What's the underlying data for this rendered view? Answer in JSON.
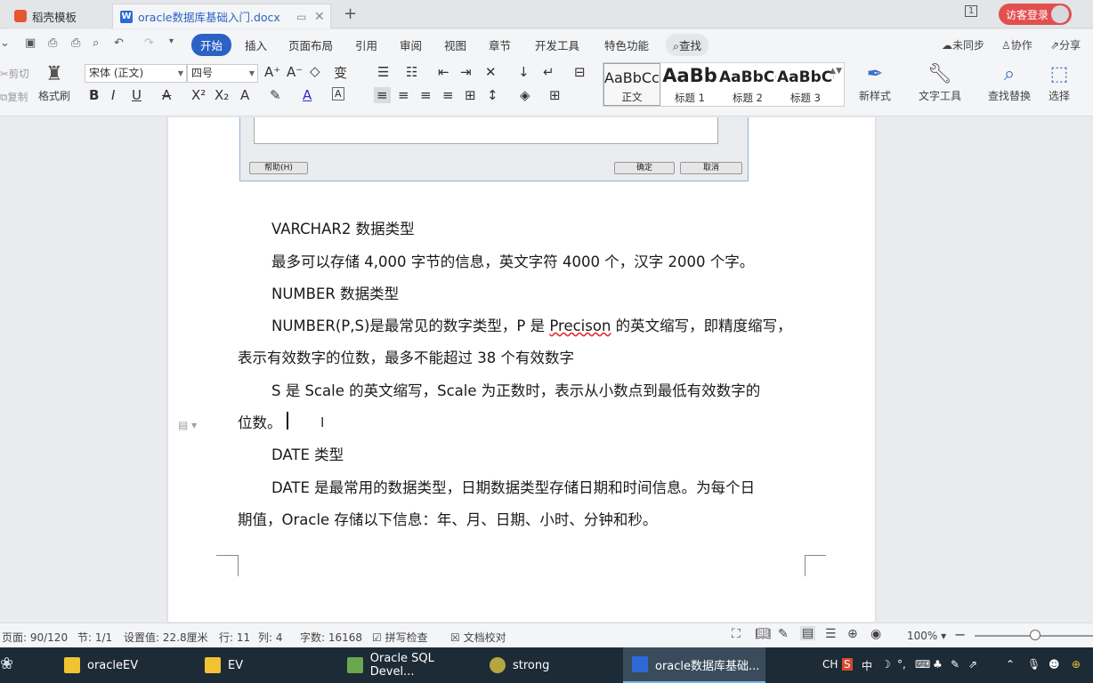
{
  "tabs": {
    "tab1": "稻壳模板",
    "tab2": "oracle数据库基础入门.docx",
    "login": "访客登录",
    "page_indicator": "1"
  },
  "menu": {
    "items": [
      "开始",
      "插入",
      "页面布局",
      "引用",
      "审阅",
      "视图",
      "章节",
      "开发工具",
      "特色功能"
    ],
    "search": "查找",
    "sync": "未同步",
    "collab": "协作",
    "share": "分享"
  },
  "ribbon": {
    "cut": "剪切",
    "copy": "复制",
    "format_painter": "格式刷",
    "font_name": "宋体 (正文)",
    "font_size": "四号",
    "styles": [
      {
        "sample": "AaBbCcI",
        "label": "正文"
      },
      {
        "sample": "AaBb",
        "label": "标题 1"
      },
      {
        "sample": "AaBbC(",
        "label": "标题 2"
      },
      {
        "sample": "AaBbC(",
        "label": "标题 3"
      }
    ],
    "new_style": "新样式",
    "text_tools": "文字工具",
    "find_replace": "查找替换",
    "select": "选择"
  },
  "dialog": {
    "help": "帮助(H)",
    "ok": "确定",
    "cancel": "取消"
  },
  "document": {
    "p1": "VARCHAR2 数据类型",
    "p2": "最多可以存储 4,000 字节的信息，英文字符 4000 个，汉字 2000 个字。",
    "p3": "NUMBER 数据类型",
    "p4a": "NUMBER(P,S)是最常见的数字类型，P  是 ",
    "p4b": "Precison",
    "p4c": " 的英文缩写，即精度缩写，",
    "p5": "表示有效数字的位数，最多不能超过 38 个有效数字",
    "p6": "S 是 Scale 的英文缩写，Scale 为正数时，表示从小数点到最低有效数字的",
    "p7": "位数。",
    "p8": "DATE 类型",
    "p9": "DATE 是最常用的数据类型，日期数据类型存储日期和时间信息。为每个日",
    "p10": "期值，Oracle  存储以下信息：年、月、日期、小时、分钟和秒。"
  },
  "status": {
    "page": "页面: 90/120",
    "section": "节: 1/1",
    "setting": "设置值: 22.8厘米",
    "row": "行: 11",
    "col": "列: 4",
    "words": "字数: 16168",
    "spell": "拼写检查",
    "proof": "文档校对",
    "zoom": "100%"
  },
  "taskbar": {
    "items": [
      "oracleEV",
      "EV",
      "Oracle SQL Devel...",
      "strong",
      "oracle数据库基础..."
    ],
    "tray": "CH"
  }
}
